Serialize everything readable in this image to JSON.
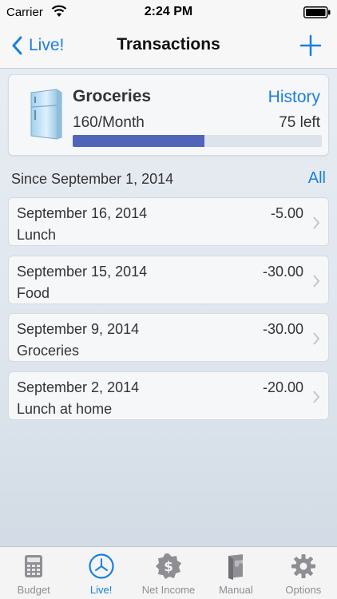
{
  "status_bar": {
    "carrier": "Carrier",
    "time": "2:24 PM"
  },
  "nav": {
    "back_label": "Live!",
    "title": "Transactions",
    "add_icon": "plus-icon"
  },
  "budget": {
    "icon": "refrigerator-icon",
    "name": "Groceries",
    "history_label": "History",
    "rate": "160/Month",
    "remaining": "75 left",
    "spent_fraction": 0.53
  },
  "section": {
    "since_label": "Since September 1, 2014",
    "all_label": "All"
  },
  "transactions": [
    {
      "date": "September 16, 2014",
      "amount": "-5.00",
      "description": "Lunch"
    },
    {
      "date": "September 15, 2014",
      "amount": "-30.00",
      "description": "Food"
    },
    {
      "date": "September 9, 2014",
      "amount": "-30.00",
      "description": "Groceries"
    },
    {
      "date": "September 2, 2014",
      "amount": "-20.00",
      "description": "Lunch at home"
    }
  ],
  "tabs": [
    {
      "label": "Budget",
      "icon": "calculator-icon",
      "active": false
    },
    {
      "label": "Live!",
      "icon": "clock-icon",
      "active": true
    },
    {
      "label": "Net Income",
      "icon": "dollar-badge-icon",
      "active": false
    },
    {
      "label": "Manual",
      "icon": "manual-icon",
      "active": false
    },
    {
      "label": "Options",
      "icon": "gear-icon",
      "active": false
    }
  ],
  "colors": {
    "accent": "#1a7fe0",
    "progress": "#5165b8",
    "inactive_tab": "#8e8e93"
  }
}
